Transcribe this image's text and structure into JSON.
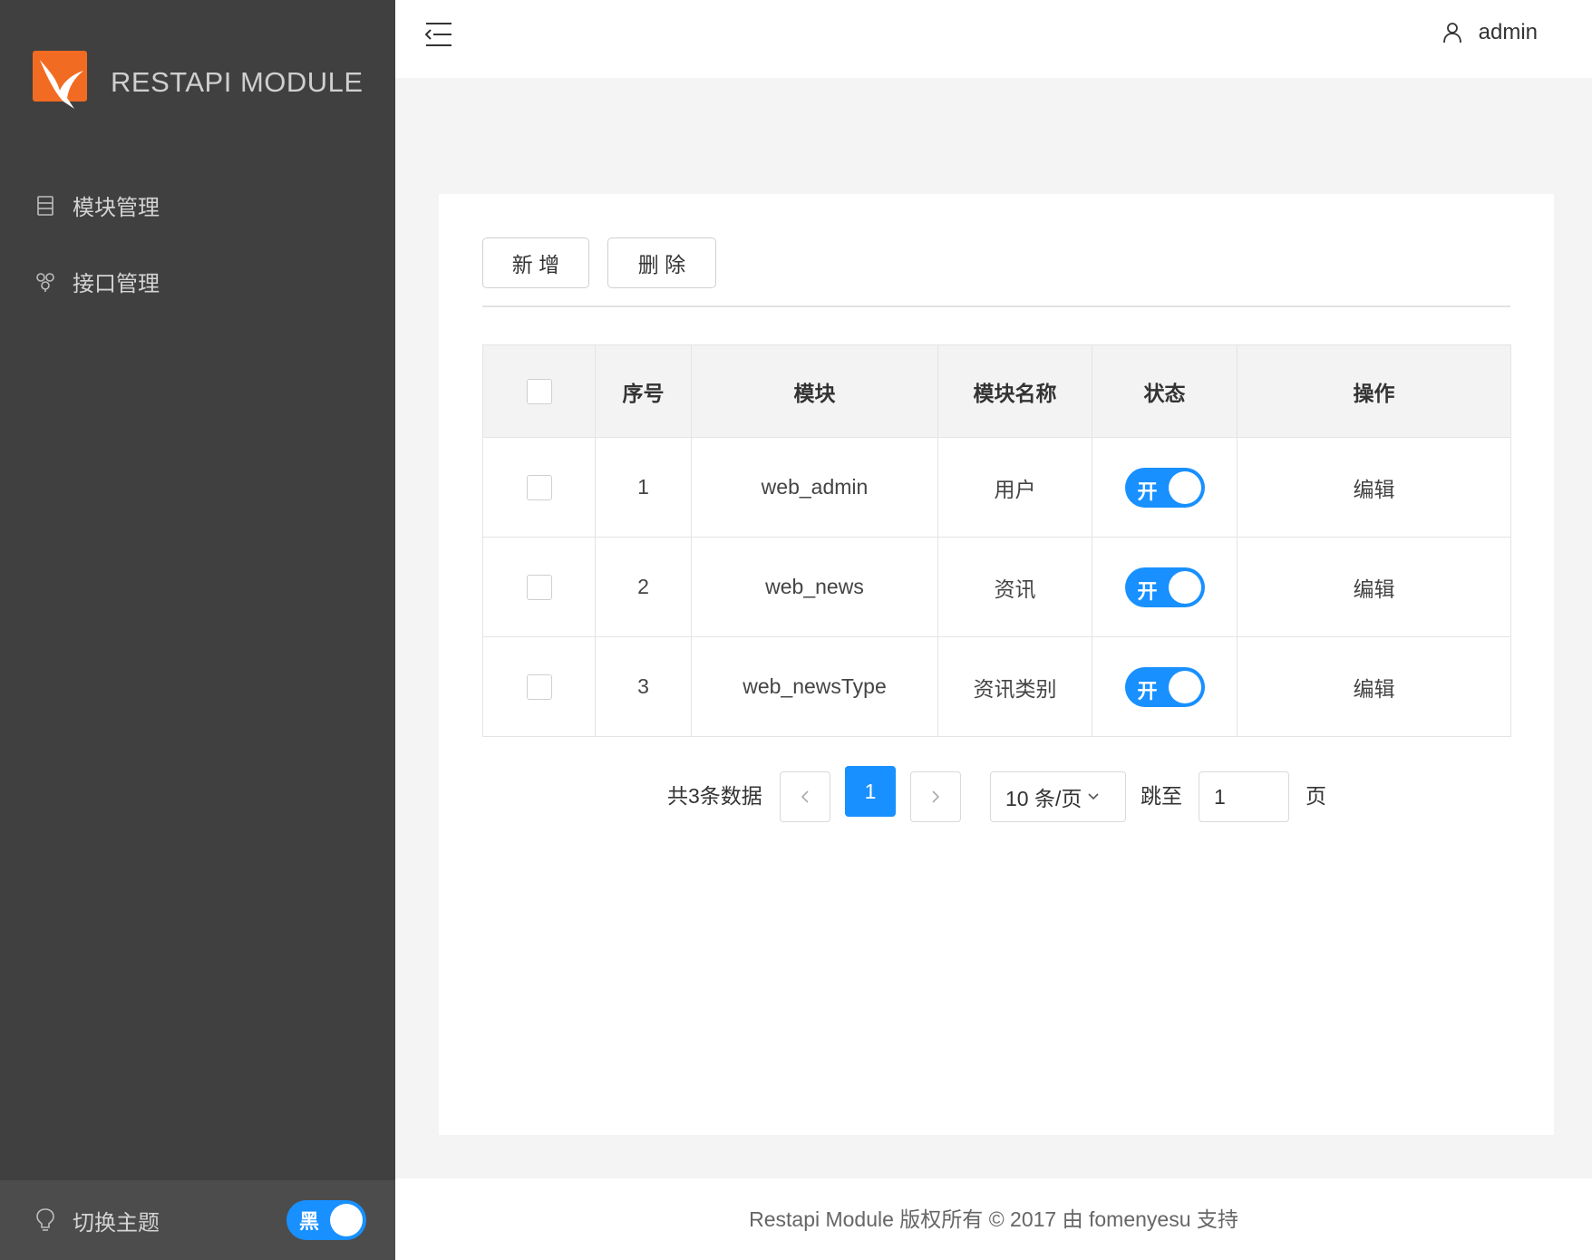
{
  "app": {
    "logo_text": "RESTAPI MODULE"
  },
  "sidebar": {
    "items": [
      {
        "label": "模块管理",
        "icon": "list-icon"
      },
      {
        "label": "接口管理",
        "icon": "cluster-icon"
      }
    ],
    "theme": {
      "label": "切换主题",
      "switch_text": "黑",
      "on": true
    }
  },
  "header": {
    "user": "admin"
  },
  "toolbar": {
    "add_label": "新 增",
    "delete_label": "删 除"
  },
  "table": {
    "columns": [
      "序号",
      "模块",
      "模块名称",
      "状态",
      "操作"
    ],
    "rows": [
      {
        "index": "1",
        "module": "web_admin",
        "name": "用户",
        "status": "开",
        "action": "编辑"
      },
      {
        "index": "2",
        "module": "web_news",
        "name": "资讯",
        "status": "开",
        "action": "编辑"
      },
      {
        "index": "3",
        "module": "web_newsType",
        "name": "资讯类别",
        "status": "开",
        "action": "编辑"
      }
    ]
  },
  "pagination": {
    "total": "共3条数据",
    "current_page": "1",
    "page_size": "10 条/页",
    "goto_label": "跳至",
    "goto_value": "1",
    "page_label": "页"
  },
  "footer": {
    "text": "Restapi Module 版权所有 © 2017 由 fomenyesu 支持"
  },
  "colors": {
    "sidebar": "#404040",
    "accent": "#1890ff",
    "logo": "#f26b22"
  }
}
